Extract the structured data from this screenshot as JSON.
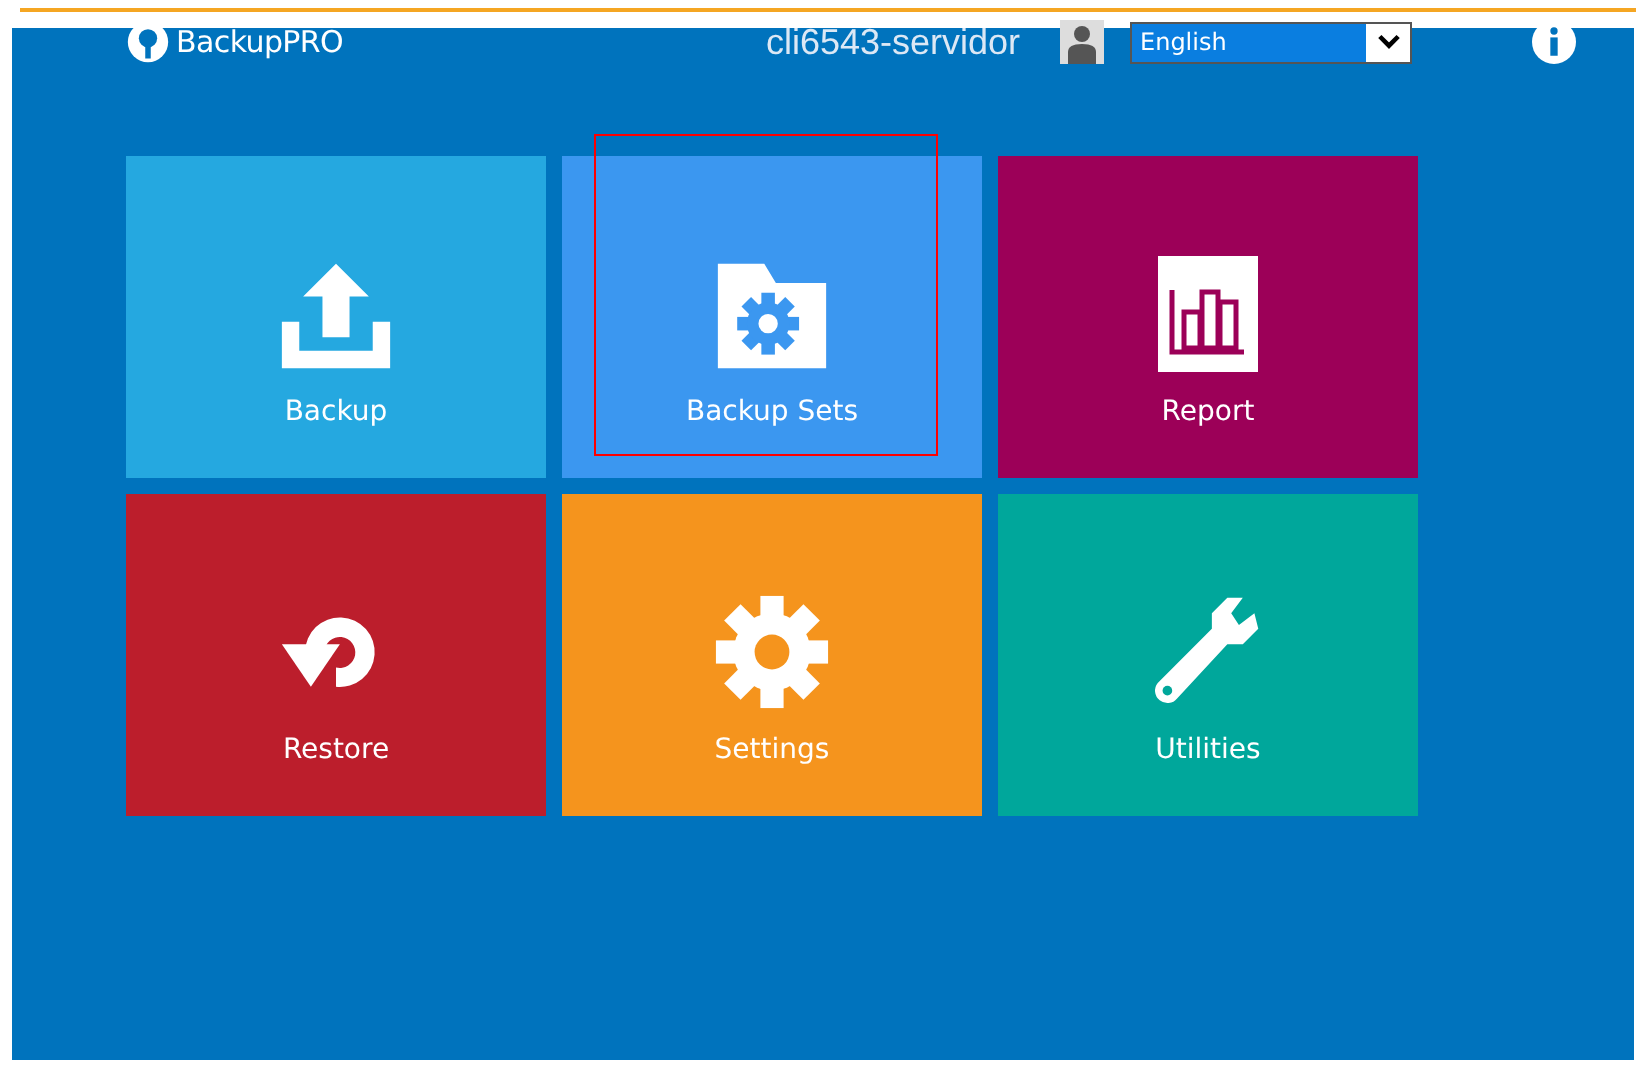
{
  "header": {
    "logo": "BackupPRO",
    "hostname": "cli6543-servidor",
    "language": {
      "value": "English"
    }
  },
  "tiles": [
    {
      "kind": "backup",
      "label": "Backup",
      "color": "#25a8e0",
      "highlighted": false
    },
    {
      "kind": "backup-sets",
      "label": "Backup Sets",
      "color": "#3b97f0",
      "highlighted": true
    },
    {
      "kind": "report",
      "label": "Report",
      "color": "#9c0058",
      "highlighted": false
    },
    {
      "kind": "restore",
      "label": "Restore",
      "color": "#bc1e2c",
      "highlighted": false
    },
    {
      "kind": "settings",
      "label": "Settings",
      "color": "#f5941d",
      "highlighted": false
    },
    {
      "kind": "utilities",
      "label": "Utilities",
      "color": "#00a79b",
      "highlighted": false
    }
  ]
}
